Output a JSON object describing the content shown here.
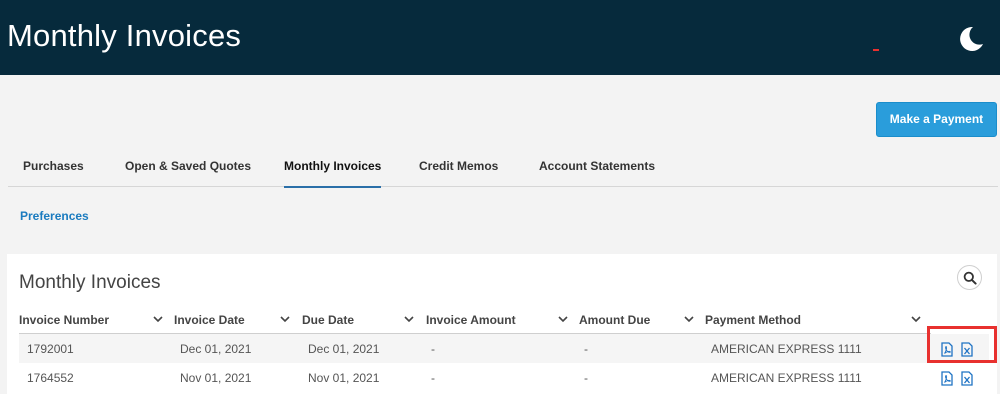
{
  "header": {
    "title": "Monthly Invoices",
    "theme_icon": "moon-icon",
    "background_color": "#062a3c"
  },
  "actions": {
    "make_payment_label": "Make a Payment",
    "accent_color": "#2a9ddb"
  },
  "tabs": [
    {
      "label": "Purchases",
      "active": false
    },
    {
      "label": "Open & Saved Quotes",
      "active": false
    },
    {
      "label": "Monthly Invoices",
      "active": true
    },
    {
      "label": "Credit Memos",
      "active": false
    },
    {
      "label": "Account Statements",
      "active": false
    }
  ],
  "preferences_link": "Preferences",
  "panel": {
    "title": "Monthly Invoices",
    "search_icon": "search-icon"
  },
  "table": {
    "columns": [
      "Invoice Number",
      "Invoice Date",
      "Due Date",
      "Invoice Amount",
      "Amount Due",
      "Payment Method"
    ],
    "rows": [
      {
        "invoice_number": "1792001",
        "invoice_date": "Dec 01, 2021",
        "due_date": "Dec 01, 2021",
        "invoice_amount": "-",
        "amount_due": "-",
        "payment_method": "AMERICAN EXPRESS 1111",
        "icons": [
          "pdf-icon",
          "excel-icon"
        ]
      },
      {
        "invoice_number": "1764552",
        "invoice_date": "Nov 01, 2021",
        "due_date": "Nov 01, 2021",
        "invoice_amount": "-",
        "amount_due": "-",
        "payment_method": "AMERICAN EXPRESS 1111",
        "icons": [
          "pdf-icon",
          "excel-icon"
        ]
      }
    ]
  },
  "highlight_color": "#e8312f"
}
